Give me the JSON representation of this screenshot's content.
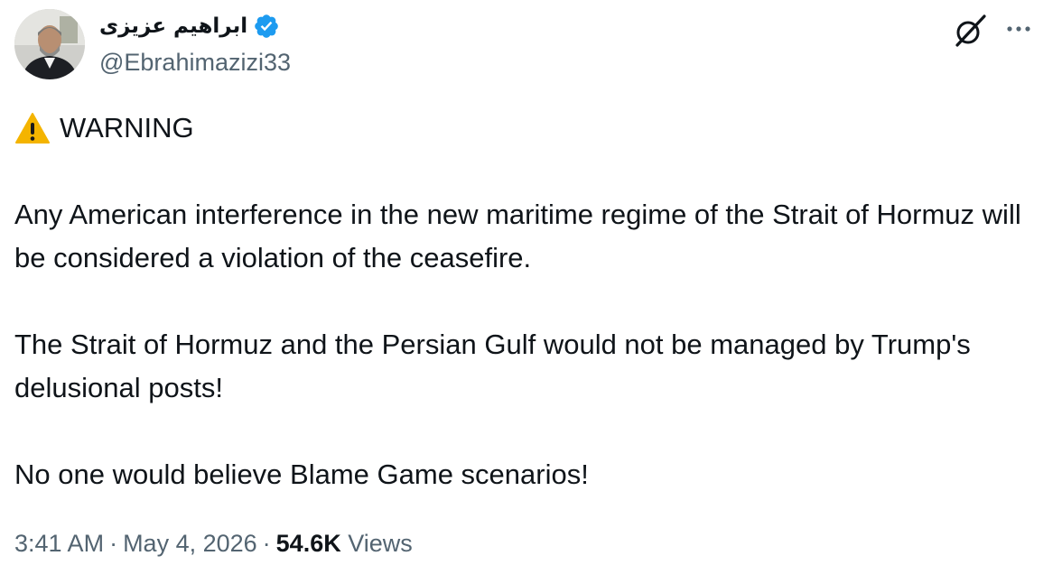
{
  "author": {
    "display_name": "ابراهیم عزیزی",
    "handle": "@Ebrahimazizi33",
    "verified": true,
    "verified_color": "#1d9bf0"
  },
  "header": {
    "grok_icon": "grok-icon",
    "more_icon": "more-icon"
  },
  "body": {
    "warning_label": "WARNING",
    "warning_icon": "warning-icon",
    "paragraphs": [
      "Any American interference in the new maritime regime of the Strait of Hormuz will be considered a violation of the ceasefire.",
      "The Strait of Hormuz and the Persian Gulf would not be managed by Trump's delusional posts!",
      "No one would believe Blame Game scenarios!"
    ]
  },
  "meta": {
    "time": "3:41 AM",
    "separator": "·",
    "date": "May 4, 2026",
    "views_count": "54.6K",
    "views_label": "Views"
  },
  "colors": {
    "text_primary": "#0f1419",
    "text_secondary": "#536471",
    "warning_yellow": "#f4b400"
  }
}
